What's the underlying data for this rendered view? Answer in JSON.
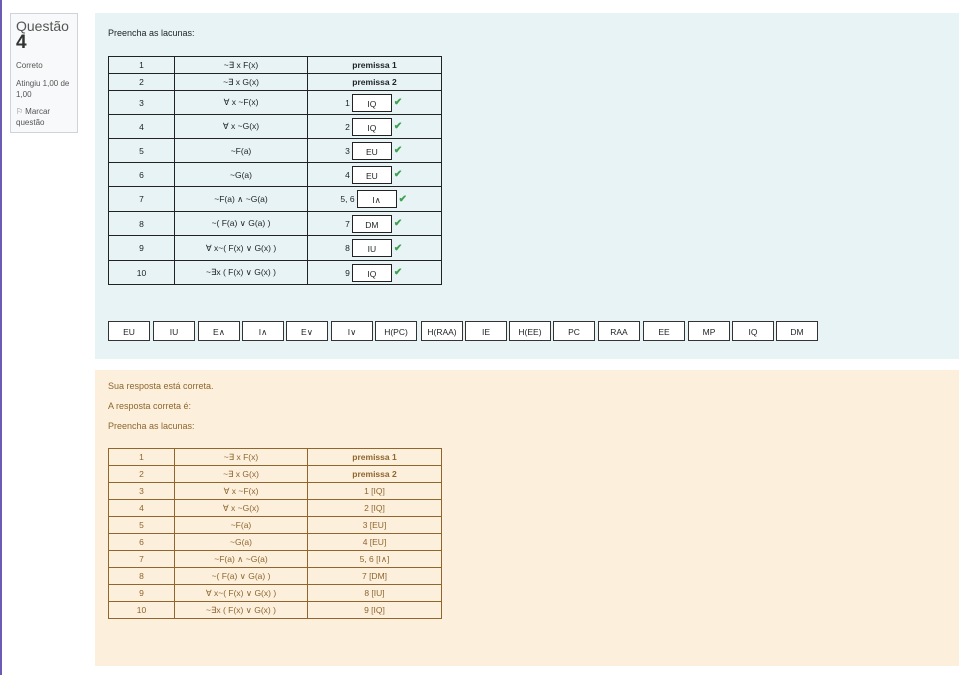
{
  "question": {
    "label": "Questão",
    "number": "4",
    "state": "Correto",
    "grade": "Atingiu 1,00 de 1,00",
    "flag_label": "Marcar questão"
  },
  "formulation": {
    "prompt": "Preencha as lacunas:",
    "rows": [
      {
        "n": "1",
        "formula": "~∃ x F(x)",
        "just": "premissa 1"
      },
      {
        "n": "2",
        "formula": "~∃ x G(x)",
        "just": "premissa 2"
      },
      {
        "n": "3",
        "formula": "∀ x ~F(x)",
        "ref": "1",
        "answer": "IQ"
      },
      {
        "n": "4",
        "formula": "∀ x ~G(x)",
        "ref": "2",
        "answer": "IQ"
      },
      {
        "n": "5",
        "formula": "~F(a)",
        "ref": "3",
        "answer": "EU"
      },
      {
        "n": "6",
        "formula": "~G(a)",
        "ref": "4",
        "answer": "EU"
      },
      {
        "n": "7",
        "formula": "~F(a) ∧ ~G(a)",
        "ref": "5, 6",
        "answer": "I∧"
      },
      {
        "n": "8",
        "formula": "~( F(a) ∨ G(a) )",
        "ref": "7",
        "answer": "DM"
      },
      {
        "n": "9",
        "formula": "∀ x~( F(x) ∨ G(x) )",
        "ref": "8",
        "answer": "IU"
      },
      {
        "n": "10",
        "formula": "~∃x ( F(x) ∨ G(x) )",
        "ref": "9",
        "answer": "IQ"
      }
    ],
    "check_icon": "✔",
    "choices": [
      "EU",
      "IU",
      "E∧",
      "I∧",
      "E∨",
      "I∨",
      "H(PC)",
      "H(RAA)",
      "IE",
      "H(EE)",
      "PC",
      "RAA",
      "EE",
      "MP",
      "IQ",
      "DM"
    ]
  },
  "feedback": {
    "status": "Sua resposta está correta.",
    "correct_label": "A resposta correta é:",
    "prompt": "Preencha as lacunas:",
    "rows": [
      {
        "n": "1",
        "formula": "~∃ x F(x)",
        "just": "premissa 1",
        "bold": true
      },
      {
        "n": "2",
        "formula": "~∃ x G(x)",
        "just": "premissa 2",
        "bold": true
      },
      {
        "n": "3",
        "formula": "∀ x ~F(x)",
        "just": "1 [IQ]"
      },
      {
        "n": "4",
        "formula": "∀ x ~G(x)",
        "just": "2 [IQ]"
      },
      {
        "n": "5",
        "formula": "~F(a)",
        "just": "3 [EU]"
      },
      {
        "n": "6",
        "formula": "~G(a)",
        "just": "4 [EU]"
      },
      {
        "n": "7",
        "formula": "~F(a) ∧ ~G(a)",
        "just": "5, 6 [I∧]"
      },
      {
        "n": "8",
        "formula": "~( F(a) ∨ G(a) )",
        "just": "7 [DM]"
      },
      {
        "n": "9",
        "formula": "∀ x~( F(x) ∨ G(x) )",
        "just": "8 [IU]"
      },
      {
        "n": "10",
        "formula": "~∃x ( F(x) ∨ G(x) )",
        "just": "9 [IQ]"
      }
    ]
  },
  "colors": {
    "formulation_bg": "#e7f3f5",
    "feedback_bg": "#fcefdc",
    "feedback_text": "#8e662e",
    "check": "#3fa14f"
  }
}
